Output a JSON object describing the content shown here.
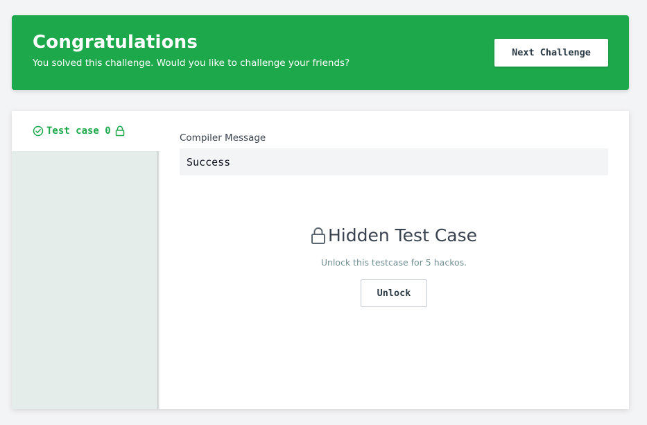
{
  "banner": {
    "title": "Congratulations",
    "subtitle": "You solved this challenge. Would you like to challenge your friends?",
    "next_button_label": "Next Challenge",
    "color": "#1ea84c"
  },
  "sidebar": {
    "tabs": [
      {
        "label": "Test case 0",
        "status_icon": "check-circle-icon",
        "lock_icon": "lock-icon"
      }
    ]
  },
  "main": {
    "compiler_label": "Compiler Message",
    "compiler_value": "Success",
    "hidden_title": "Hidden Test Case",
    "hidden_title_icon": "lock-icon",
    "hidden_description": "Unlock this testcase for 5 hackos.",
    "unlock_button_label": "Unlock"
  }
}
